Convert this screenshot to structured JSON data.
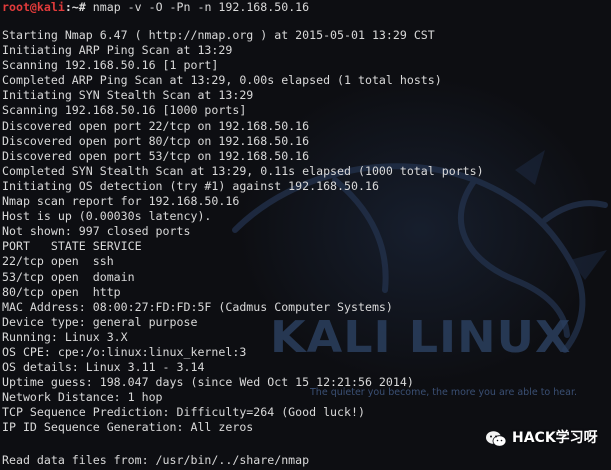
{
  "prompt": {
    "user_host": "root@kali",
    "path": ":~#",
    "command": " nmap -v -O -Pn -n 192.168.50.16"
  },
  "output_lines": [
    "Starting Nmap 6.47 ( http://nmap.org ) at 2015-05-01 13:29 CST",
    "Initiating ARP Ping Scan at 13:29",
    "Scanning 192.168.50.16 [1 port]",
    "Completed ARP Ping Scan at 13:29, 0.00s elapsed (1 total hosts)",
    "Initiating SYN Stealth Scan at 13:29",
    "Scanning 192.168.50.16 [1000 ports]",
    "Discovered open port 22/tcp on 192.168.50.16",
    "Discovered open port 80/tcp on 192.168.50.16",
    "Discovered open port 53/tcp on 192.168.50.16",
    "Completed SYN Stealth Scan at 13:29, 0.11s elapsed (1000 total ports)",
    "Initiating OS detection (try #1) against 192.168.50.16",
    "Nmap scan report for 192.168.50.16",
    "Host is up (0.00030s latency).",
    "Not shown: 997 closed ports",
    "PORT   STATE SERVICE",
    "22/tcp open  ssh",
    "53/tcp open  domain",
    "80/tcp open  http",
    "MAC Address: 08:00:27:FD:FD:5F (Cadmus Computer Systems)",
    "Device type: general purpose",
    "Running: Linux 3.X",
    "OS CPE: cpe:/o:linux:linux_kernel:3",
    "OS details: Linux 3.11 - 3.14",
    "Uptime guess: 198.047 days (since Wed Oct 15 12:21:56 2014)",
    "Network Distance: 1 hop",
    "TCP Sequence Prediction: Difficulty=264 (Good luck!)",
    "IP ID Sequence Generation: All zeros"
  ],
  "bottom_line": "Read data files from: /usr/bin/../share/nmap",
  "wallpaper": {
    "logo_text": "KALI LINUX",
    "tagline": "The quieter you become, the more you are able to hear."
  },
  "watermark": {
    "text": "HACK学习呀",
    "icon": "wechat-icon"
  },
  "colors": {
    "background": "#0d0e12",
    "text": "#d9d9d9",
    "prompt_user": "#e23b3b",
    "logo": "#2b3f5e"
  }
}
